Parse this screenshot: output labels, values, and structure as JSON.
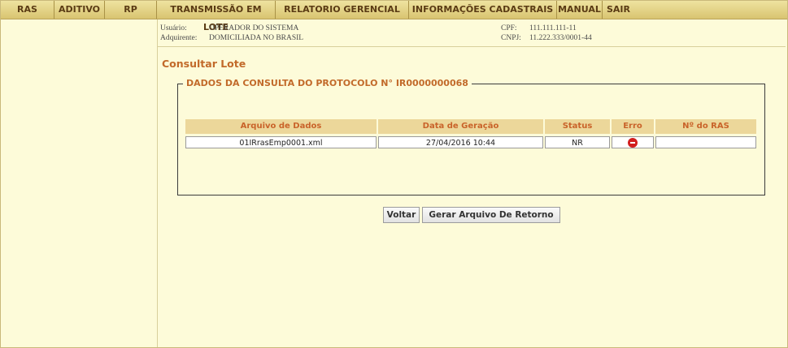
{
  "menu": [
    "RAS",
    "ADITIVO",
    "RP",
    "TRANSMISSÃO EM LOTE",
    "RELATORIO GERENCIAL",
    "INFORMAÇÕES CADASTRAIS",
    "MANUAL",
    "SAIR"
  ],
  "info": {
    "usuario_label": "Usuário:",
    "usuario_value": "OPERADOR DO SISTEMA",
    "adquirente_label": "Adquirente:",
    "adquirente_value": "DOMICILIADA NO BRASIL",
    "cpf_label": "CPF:",
    "cpf_value": "111.111.111-11",
    "cnpj_label": "CNPJ:",
    "cnpj_value": "11.222.333/0001-44"
  },
  "page_title": "Consultar Lote",
  "fieldset_legend": "DADOS DA CONSULTA DO PROTOCOLO N° IR0000000068",
  "table": {
    "headers": [
      "Arquivo de Dados",
      "Data de Geração",
      "Status",
      "Erro",
      "Nº do RAS"
    ],
    "rows": [
      {
        "arquivo": "01IRrasEmp0001.xml",
        "data": "27/04/2016 10:44",
        "status": "NR",
        "erro_icon": "error-icon",
        "nras": ""
      }
    ]
  },
  "buttons": {
    "voltar": "Voltar",
    "gerar": "Gerar Arquivo De Retorno"
  },
  "colors": {
    "menu_bg": "#d9c470",
    "accent": "#c26a2a",
    "header_bg": "#ecd79a",
    "page_bg": "#fdfbd9",
    "error": "#d21e1e"
  }
}
